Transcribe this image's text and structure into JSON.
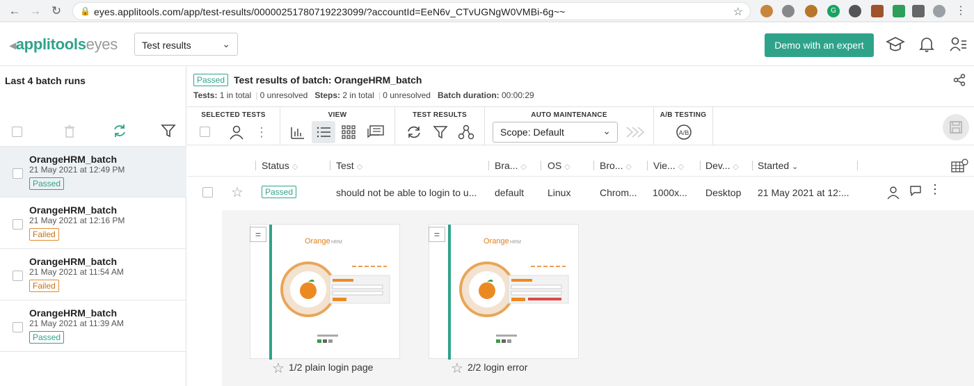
{
  "browser": {
    "url": "eyes.applitools.com/app/test-results/00000251780719223099/?accountId=EeN6v_CTvUGNgW0VMBi-6g~~"
  },
  "app": {
    "logo_text": "applitools",
    "logo_suffix": "eyes",
    "view_select": "Test results",
    "demo_button": "Demo with an expert",
    "accent": "#2fa38a"
  },
  "sidebar": {
    "title": "Last 4 batch runs",
    "batches": [
      {
        "name": "OrangeHRM_batch",
        "date": "21 May 2021 at 12:49 PM",
        "status": "Passed"
      },
      {
        "name": "OrangeHRM_batch",
        "date": "21 May 2021 at 12:16 PM",
        "status": "Failed"
      },
      {
        "name": "OrangeHRM_batch",
        "date": "21 May 2021 at 11:54 AM",
        "status": "Failed"
      },
      {
        "name": "OrangeHRM_batch",
        "date": "21 May 2021 at 11:39 AM",
        "status": "Passed"
      }
    ]
  },
  "header": {
    "status": "Passed",
    "title": "Test results of batch: OrangeHRM_batch",
    "tests_label": "Tests:",
    "tests_value": "1 in total",
    "tests_unresolved": "0 unresolved",
    "steps_label": "Steps:",
    "steps_value": "2 in total",
    "steps_unresolved": "0 unresolved",
    "duration_label": "Batch duration:",
    "duration_value": "00:00:29"
  },
  "toolbar": {
    "selected_tests": "SELECTED TESTS",
    "view": "VIEW",
    "test_results": "TEST RESULTS",
    "auto_maintenance": "AUTO MAINTENANCE",
    "scope": "Scope: Default",
    "ab_testing": "A/B TESTING"
  },
  "table": {
    "columns": [
      "Status",
      "Test",
      "Bra...",
      "OS",
      "Bro...",
      "Vie...",
      "Dev...",
      "Started"
    ],
    "row": {
      "status": "Passed",
      "test": "should not be able to login to u...",
      "branch": "default",
      "os": "Linux",
      "browser": "Chrom...",
      "viewport": "1000x...",
      "device": "Desktop",
      "started": "21 May 2021 at 12:..."
    }
  },
  "steps": [
    {
      "caption": "1/2 plain login page"
    },
    {
      "caption": "2/2 login error"
    }
  ]
}
